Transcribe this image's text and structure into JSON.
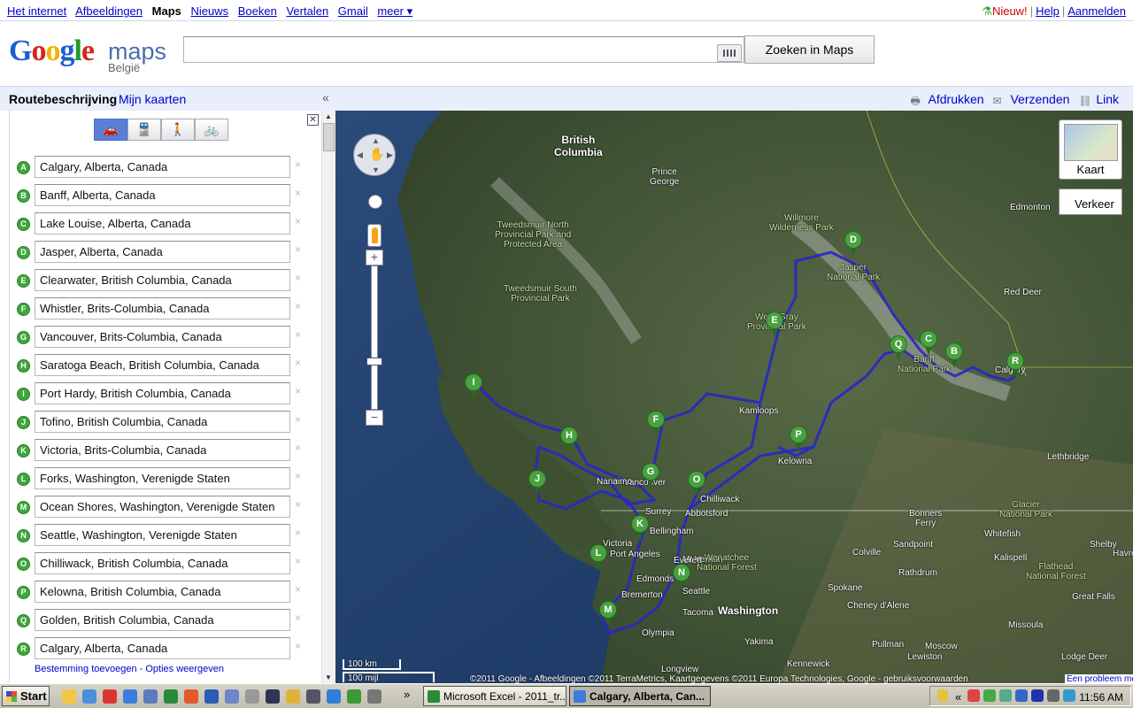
{
  "topnav": {
    "links": [
      "Het internet",
      "Afbeeldingen",
      "Maps",
      "Nieuws",
      "Boeken",
      "Vertalen",
      "Gmail",
      "meer ▾"
    ],
    "current": "Maps",
    "new_label": "Nieuw!",
    "help": "Help",
    "signin": "Aanmelden"
  },
  "header": {
    "logo_letters": [
      "G",
      "o",
      "o",
      "g",
      "l",
      "e"
    ],
    "logo_maps": "maps",
    "country": "België",
    "search_value": "",
    "search_button": "Zoeken in Maps"
  },
  "panelbar": {
    "title": "Routebeschrijving",
    "my_maps": "Mijn kaarten",
    "collapse": "«",
    "print": "Afdrukken",
    "send": "Verzenden",
    "link": "Link"
  },
  "directions": {
    "close_icon": "close-x",
    "modes": [
      {
        "name": "car-icon",
        "glyph": "🚗",
        "selected": true
      },
      {
        "name": "train-icon",
        "glyph": "🚆",
        "selected": false
      },
      {
        "name": "walk-icon",
        "glyph": "🚶",
        "selected": false
      },
      {
        "name": "bike-icon",
        "glyph": "🚲",
        "selected": false
      }
    ],
    "waypoints": [
      {
        "letter": "A",
        "value": "Calgary, Alberta, Canada"
      },
      {
        "letter": "B",
        "value": "Banff, Alberta, Canada"
      },
      {
        "letter": "C",
        "value": "Lake Louise, Alberta, Canada"
      },
      {
        "letter": "D",
        "value": "Jasper, Alberta, Canada"
      },
      {
        "letter": "E",
        "value": "Clearwater, British Columbia, Canada"
      },
      {
        "letter": "F",
        "value": "Whistler, Brits-Columbia, Canada"
      },
      {
        "letter": "G",
        "value": "Vancouver, Brits-Columbia, Canada"
      },
      {
        "letter": "H",
        "value": "Saratoga Beach, British Columbia, Canada"
      },
      {
        "letter": "I",
        "value": "Port Hardy, British Columbia, Canada"
      },
      {
        "letter": "J",
        "value": "Tofino, British Columbia, Canada"
      },
      {
        "letter": "K",
        "value": "Victoria, Brits-Columbia, Canada"
      },
      {
        "letter": "L",
        "value": "Forks, Washington, Verenigde Staten"
      },
      {
        "letter": "M",
        "value": "Ocean Shores, Washington, Verenigde Staten"
      },
      {
        "letter": "N",
        "value": "Seattle, Washington, Verenigde Staten"
      },
      {
        "letter": "O",
        "value": "Chilliwack, British Columbia, Canada"
      },
      {
        "letter": "P",
        "value": "Kelowna, British Columbia, Canada"
      },
      {
        "letter": "Q",
        "value": "Golden, British Columbia, Canada"
      },
      {
        "letter": "R",
        "value": "Calgary, Alberta, Canada"
      }
    ],
    "remove_glyph": "×",
    "add_destination": "Bestemming toevoegen",
    "separator": " - ",
    "show_options": "Opties weergeven"
  },
  "map": {
    "kaart_label": "Kaart",
    "verkeer_label": "Verkeer",
    "scale_km": "100 km",
    "scale_mi": "100 mijl",
    "copyright": "©2011 Google - Afbeeldingen ©2011 TerraMetrics, Kaartgegevens ©2011 Europa Technologies, Google - gebruiksvoorwaarden",
    "report": "Een probleem melden",
    "labels": [
      {
        "text": "British\nColumbia",
        "big": true
      },
      {
        "text": "Prince\nGeorge"
      },
      {
        "text": "Edmonton"
      },
      {
        "text": "Willmore\nWilderness Park",
        "park": true
      },
      {
        "text": "Tweedsmuir North\nProvincial Park and\nProtected Area",
        "park": true
      },
      {
        "text": "Tweedsmuir South\nProvincial Park",
        "park": true
      },
      {
        "text": "Jasper\nNational Park",
        "park": true
      },
      {
        "text": "Red Deer"
      },
      {
        "text": "Wells Gray\nProvincial Park",
        "park": true
      },
      {
        "text": "Banff\nNational Park",
        "park": true
      },
      {
        "text": "Calgary"
      },
      {
        "text": "Kamloops"
      },
      {
        "text": "Kelowna"
      },
      {
        "text": "Lethbridge"
      },
      {
        "text": "Vancouver"
      },
      {
        "text": "Surrey"
      },
      {
        "text": "Abbotsford"
      },
      {
        "text": "Chilliwack"
      },
      {
        "text": "Nanaimo"
      },
      {
        "text": "Bellingham"
      },
      {
        "text": "Victoria"
      },
      {
        "text": "Port Angeles"
      },
      {
        "text": "Mt Vernon"
      },
      {
        "text": "Everett"
      },
      {
        "text": "Edmonds"
      },
      {
        "text": "Bremerton"
      },
      {
        "text": "Seattle"
      },
      {
        "text": "Tacoma"
      },
      {
        "text": "Olympia"
      },
      {
        "text": "Washington",
        "big": true
      },
      {
        "text": "Wenatchee\nNational Forest",
        "park": true
      },
      {
        "text": "Yakima"
      },
      {
        "text": "Kennewick"
      },
      {
        "text": "Longview"
      },
      {
        "text": "Spokane"
      },
      {
        "text": "Cheney d'Alene"
      },
      {
        "text": "Pullman"
      },
      {
        "text": "Lewiston"
      },
      {
        "text": "Moscow"
      },
      {
        "text": "Colville"
      },
      {
        "text": "Sandpoint"
      },
      {
        "text": "Bonners\nFerry"
      },
      {
        "text": "Whitefish"
      },
      {
        "text": "Kalispell"
      },
      {
        "text": "Glacier\nNational Park",
        "park": true
      },
      {
        "text": "Flathead\nNational Forest",
        "park": true
      },
      {
        "text": "Rathdrum"
      },
      {
        "text": "Missoula"
      },
      {
        "text": "Great Falls"
      },
      {
        "text": "Shelby"
      },
      {
        "text": "Lodge Deer"
      },
      {
        "text": "Havre"
      }
    ],
    "pins": [
      "A",
      "B",
      "C",
      "D",
      "E",
      "F",
      "G",
      "H",
      "I",
      "J",
      "K",
      "L",
      "M",
      "N",
      "O",
      "P",
      "Q",
      "R"
    ]
  },
  "taskbar": {
    "start": "Start",
    "more": "»",
    "tasks": [
      {
        "label": "Microsoft Excel - 2011_tr...",
        "active": false
      },
      {
        "label": "Calgary, Alberta, Can...",
        "active": true
      }
    ],
    "tray_more": "«",
    "clock": "11:56 AM"
  }
}
